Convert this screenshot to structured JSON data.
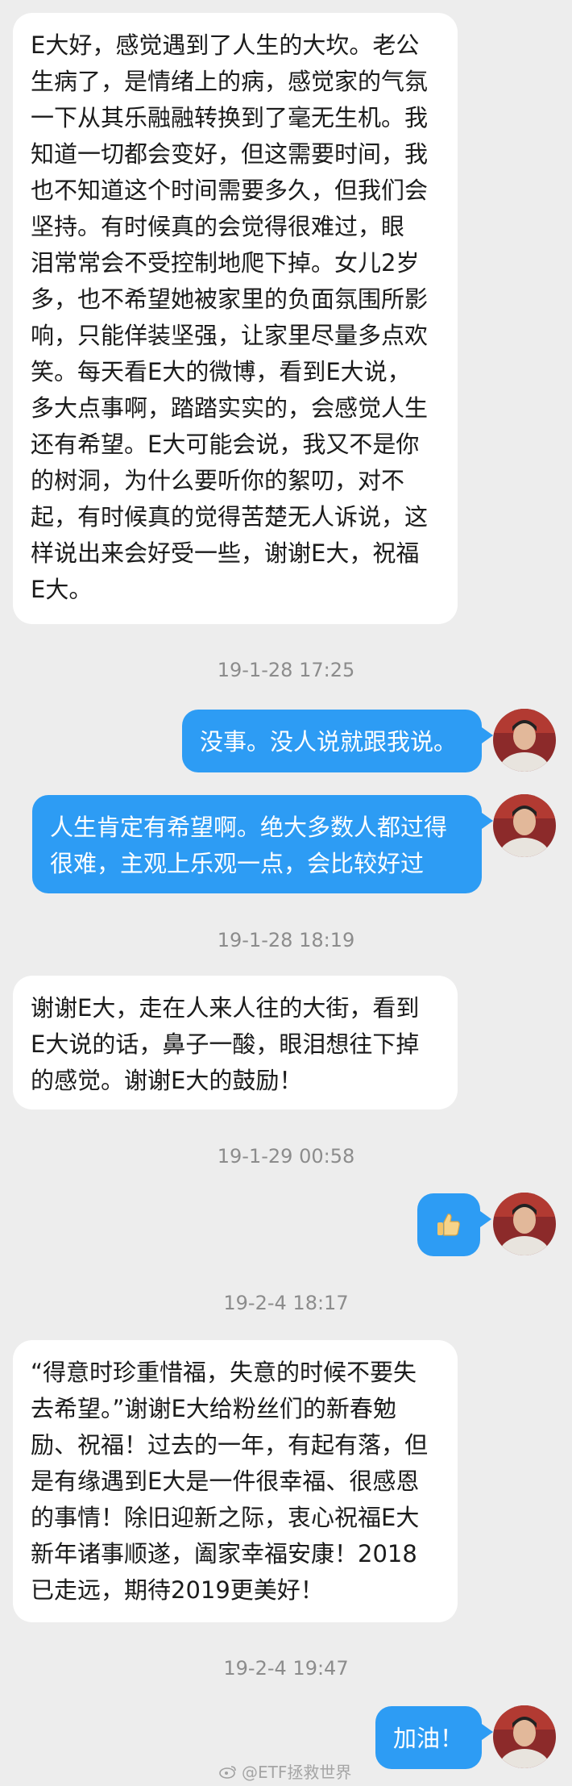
{
  "messages": [
    {
      "type": "incoming",
      "text": "E大好，感觉遇到了人生的大坎。老公\n生病了，是情绪上的病，感觉家的气氛\n一下从其乐融融转换到了毫无生机。我\n知道一切都会变好，但这需要时间，我\n也不知道这个时间需要多久，但我们会\n坚持。有时候真的会觉得很难过，眼\n泪常常会不受控制地爬下掉。女儿2岁\n多，也不希望她被家里的负面氛围所影\n响，只能佯装坚强，让家里尽量多点欢\n笑。每天看E大的微博，看到E大说，\n多大点事啊，踏踏实实的，会感觉人生\n还有希望。E大可能会说，我又不是你\n的树洞，为什么要听你的絮叨，对不\n起，有时候真的觉得苦楚无人诉说，这\n样说出来会好受一些，谢谢E大，祝福\nE大。"
    },
    {
      "type": "timestamp",
      "text": "19-1-28 17:25"
    },
    {
      "type": "outgoing",
      "text": "没事。没人说就跟我说。"
    },
    {
      "type": "outgoing",
      "text": "人生肯定有希望啊。绝大多数人都过得\n很难，主观上乐观一点，会比较好过"
    },
    {
      "type": "timestamp",
      "text": "19-1-28 18:19"
    },
    {
      "type": "incoming",
      "text": "谢谢E大，走在人来人往的大街，看到\nE大说的话，鼻子一酸，眼泪想往下掉\n的感觉。谢谢E大的鼓励！"
    },
    {
      "type": "timestamp",
      "text": "19-1-29 00:58"
    },
    {
      "type": "outgoing",
      "text": "",
      "icon": "thumbs-up-icon"
    },
    {
      "type": "timestamp",
      "text": "19-2-4 18:17"
    },
    {
      "type": "incoming",
      "text": "“得意时珍重惜福，失意的时候不要失\n去希望。”谢谢E大给粉丝们的新春勉\n励、祝福！过去的一年，有起有落，但\n是有缘遇到E大是一件很幸福、很感恩\n的事情！除旧迎新之际，衷心祝福E大\n新年诸事顺遂，阖家幸福安康！2018\n已走远，期待2019更美好！"
    },
    {
      "type": "timestamp",
      "text": "19-2-4 19:47"
    },
    {
      "type": "outgoing",
      "text": "加油！"
    }
  ],
  "watermark": "@ETF拯救世界",
  "colors": {
    "background": "#ededed",
    "incoming_bubble": "#ffffff",
    "outgoing_bubble": "#2d9cf4"
  }
}
